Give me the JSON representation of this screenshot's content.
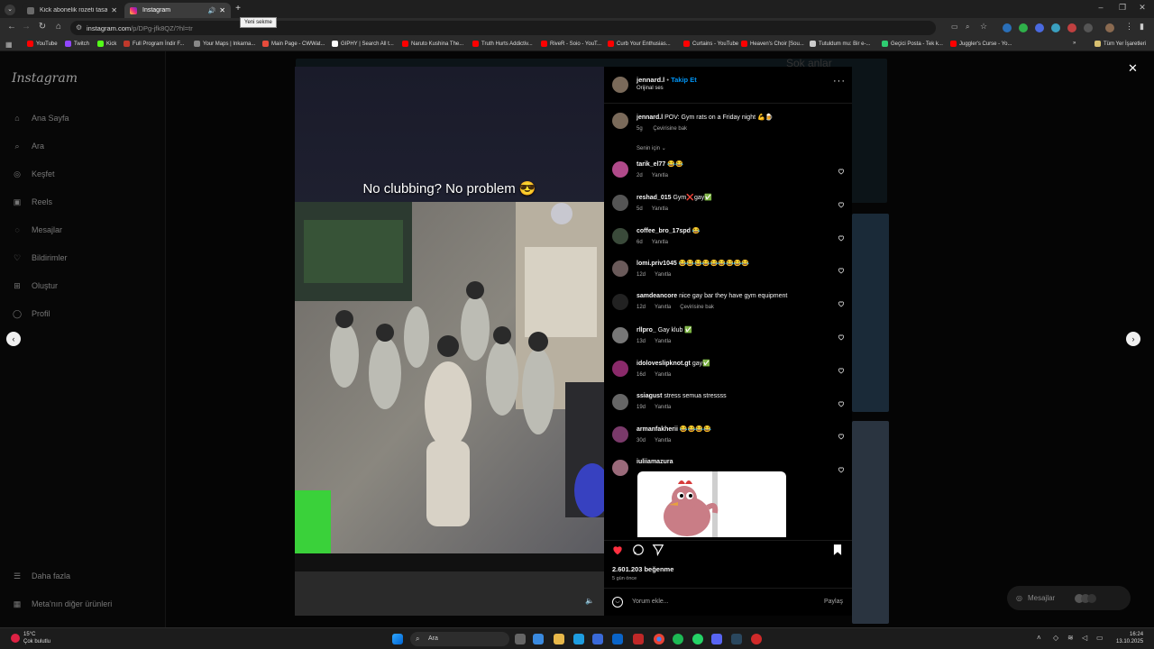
{
  "browser": {
    "tabs": [
      {
        "title": "Kick abonelik rozeti tasarımı",
        "active": false,
        "favicon_color": "#6a6a6a"
      },
      {
        "title": "Instagram",
        "active": true,
        "favicon_color": "#d6249f"
      }
    ],
    "new_tab_tooltip": "Yeni sekme",
    "url_host": "instagram.com",
    "url_path": "/p/DPg-jfk8QZ/?hl=tr",
    "bookmarks": [
      {
        "label": "YouTube",
        "color": "#ff0000"
      },
      {
        "label": "Twitch",
        "color": "#9146ff"
      },
      {
        "label": "Kick",
        "color": "#53fc18"
      },
      {
        "label": "Full Program İndir F...",
        "color": "#c0392b"
      },
      {
        "label": "Your Maps | Inkarna...",
        "color": "#888888"
      },
      {
        "label": "Main Page - CWWat...",
        "color": "#e74c3c"
      },
      {
        "label": "GIPHY | Search All t...",
        "color": "#ffffff"
      },
      {
        "label": "Naruto Kushina The...",
        "color": "#ff0000"
      },
      {
        "label": "Truth Hurts Addictiv...",
        "color": "#ff0000"
      },
      {
        "label": "RiveR - Soio - YouT...",
        "color": "#ff0000"
      },
      {
        "label": "Curb Your Enthusias...",
        "color": "#ff0000"
      },
      {
        "label": "Curtains - YouTube",
        "color": "#ff0000"
      },
      {
        "label": "Heaven's Choir [Sou...",
        "color": "#ff0000"
      },
      {
        "label": "Tutuldum mu: Bir e-...",
        "color": "#cccccc"
      },
      {
        "label": "Geçici Posta - Tek k...",
        "color": "#2ecc71"
      },
      {
        "label": "Juggler's Curse - Yo...",
        "color": "#ff0000"
      }
    ],
    "all_bookmarks_label": "Tüm Yer İşaretleri"
  },
  "sidebar": {
    "logo": "Instagram",
    "items": [
      {
        "label": "Ana Sayfa",
        "icon": "home-icon"
      },
      {
        "label": "Ara",
        "icon": "search-icon"
      },
      {
        "label": "Keşfet",
        "icon": "compass-icon"
      },
      {
        "label": "Reels",
        "icon": "reels-icon"
      },
      {
        "label": "Mesajlar",
        "icon": "messenger-icon"
      },
      {
        "label": "Bildirimler",
        "icon": "heart-icon"
      },
      {
        "label": "Oluştur",
        "icon": "plus-square-icon"
      },
      {
        "label": "Profil",
        "icon": "profile-icon"
      }
    ],
    "more_label": "Daha fazla",
    "meta_label": "Meta'nın diğer ürünleri"
  },
  "backdrop": {
    "caption_top": "Şok anlar"
  },
  "post": {
    "video_caption": "No clubbing? No problem 😎",
    "author": "jennard.l",
    "follow_label": "Takip Et",
    "audio_label": "Orijinal ses",
    "caption": {
      "user": "jennard.l",
      "text": "POV: Gym rats on a Friday night 💪🍺",
      "age": "5g",
      "translate": "Çevirisine bak"
    },
    "sort_label": "Senin için",
    "comments": [
      {
        "user": "tarik_el77",
        "text": "😂😂",
        "age": "2d",
        "reply": "Yanıtla",
        "avatar_color": "#b04a8a"
      },
      {
        "user": "reshad_015",
        "text": "Gym❌gay✅",
        "age": "5d",
        "reply": "Yanıtla",
        "avatar_color": "#555555"
      },
      {
        "user": "coffee_bro_17spd",
        "text": "😂",
        "age": "6d",
        "reply": "Yanıtla",
        "avatar_color": "#3a4a3a"
      },
      {
        "user": "lomi.priv1045",
        "text": "😂😂😂😂😂😂😂😂😂",
        "age": "12d",
        "reply": "Yanıtla",
        "avatar_color": "#6a5a5a"
      },
      {
        "user": "samdeancore",
        "text": "nice gay bar they have gym equipment",
        "age": "12d",
        "reply": "Yanıtla",
        "translate": "Çevirisine bak",
        "avatar_color": "#222222"
      },
      {
        "user": "rllpro_",
        "text": "Gay klub ✅",
        "age": "13d",
        "reply": "Yanıtla",
        "avatar_color": "#777777"
      },
      {
        "user": "idoloveslipknot.gt",
        "text": "gay✅",
        "age": "16d",
        "reply": "Yanıtla",
        "avatar_color": "#8a2a6a"
      },
      {
        "user": "ssiagust",
        "text": "stress semua stressss",
        "age": "19d",
        "reply": "Yanıtla",
        "avatar_color": "#666666"
      },
      {
        "user": "armanfakherii",
        "text": "😂😂😂😂",
        "age": "30d",
        "reply": "Yanıtla",
        "avatar_color": "#7a3a6a"
      },
      {
        "user": "iuliiamazura",
        "text": "",
        "age": "",
        "reply": "",
        "avatar_color": "#9a6a7a"
      }
    ],
    "likes": "2.601.203 beğenme",
    "posted": "5 gün önce",
    "comment_placeholder": "Yorum ekle...",
    "share_label": "Paylaş"
  },
  "messages_fab": {
    "label": "Mesajlar"
  },
  "taskbar": {
    "weather_temp": "15°C",
    "weather_text": "Çok bulutlu",
    "search_label": "Ara",
    "time": "16:24",
    "date": "13.10.2025"
  },
  "colors": {
    "accent": "#0095f6",
    "like_red": "#ff3040",
    "panel_bg": "#000000",
    "secondary_text": "#a8a8a8"
  }
}
